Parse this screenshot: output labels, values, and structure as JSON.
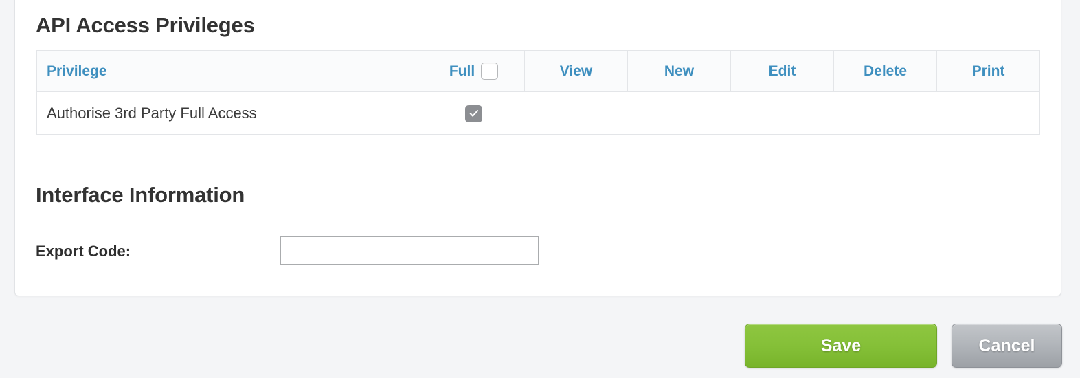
{
  "panel": {
    "api_section": {
      "title": "API Access Privileges",
      "table": {
        "columns": [
          {
            "key": "privilege",
            "label": "Privilege"
          },
          {
            "key": "full",
            "label": "Full"
          },
          {
            "key": "view",
            "label": "View"
          },
          {
            "key": "new",
            "label": "New"
          },
          {
            "key": "edit",
            "label": "Edit"
          },
          {
            "key": "delete",
            "label": "Delete"
          },
          {
            "key": "print",
            "label": "Print"
          }
        ],
        "header_full_checkbox": {
          "checked": false,
          "icon": "checkbox-unchecked-icon"
        },
        "rows": [
          {
            "privilege": "Authorise 3rd Party Full Access",
            "full": {
              "checked": true,
              "disabled": true,
              "icon": "checkbox-checked-icon"
            },
            "view": "",
            "new": "",
            "edit": "",
            "delete": "",
            "print": ""
          }
        ]
      }
    },
    "interface_section": {
      "title": "Interface Information",
      "export_code": {
        "label": "Export Code:",
        "value": "",
        "placeholder": ""
      }
    }
  },
  "footer": {
    "save_label": "Save",
    "cancel_label": "Cancel"
  },
  "colors": {
    "page_background": "#f4f5f7",
    "panel_background": "#ffffff",
    "header_link_blue": "#3e8fbf",
    "heading_text": "#333333",
    "save_green": "#85c038",
    "cancel_gray": "#b2b6bb",
    "checkbox_checked_gray": "#8c8e92",
    "table_border": "#e3e5e8"
  }
}
